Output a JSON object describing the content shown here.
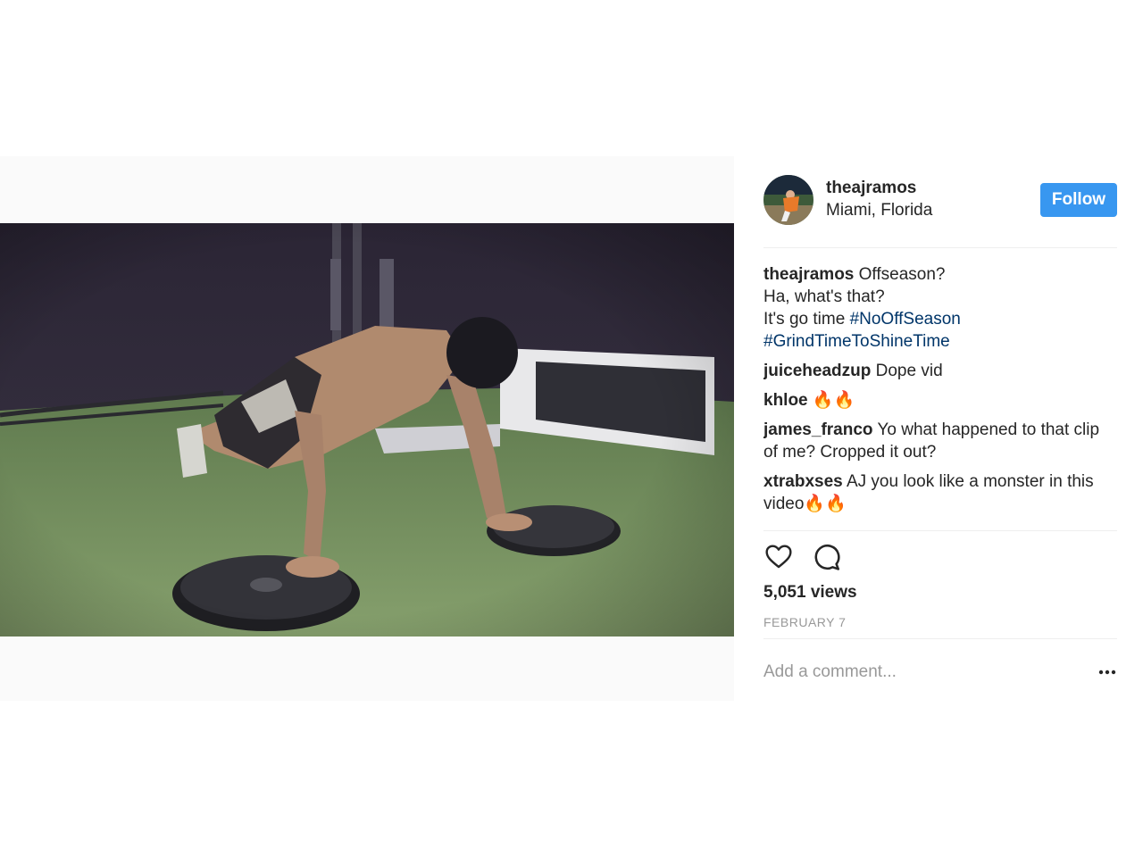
{
  "post": {
    "username": "theajramos",
    "location": "Miami, Florida",
    "follow_label": "Follow",
    "views": "5,051 views",
    "date": "FEBRUARY 7",
    "comment_placeholder": "Add a comment..."
  },
  "caption": {
    "user": "theajramos",
    "line1": "Offseason?",
    "line2": "Ha, what's that?",
    "line3": "It's go time",
    "tag1": "#NoOffSeason",
    "tag2": "#GrindTimeToShineTime"
  },
  "comments": [
    {
      "user": "juiceheadzup",
      "text": "Dope vid"
    },
    {
      "user": "khloe",
      "text": "🔥🔥"
    },
    {
      "user": "james_franco",
      "text": "Yo what happened to that clip of me? Cropped it out?"
    },
    {
      "user": "xtrabxses",
      "text": "AJ you look like a monster in this video🔥🔥"
    }
  ],
  "colors": {
    "follow_bg": "#3897f0",
    "hashtag": "#003569",
    "muted": "#999999"
  },
  "icons": [
    "heart-icon",
    "comment-icon",
    "more-options-icon"
  ]
}
